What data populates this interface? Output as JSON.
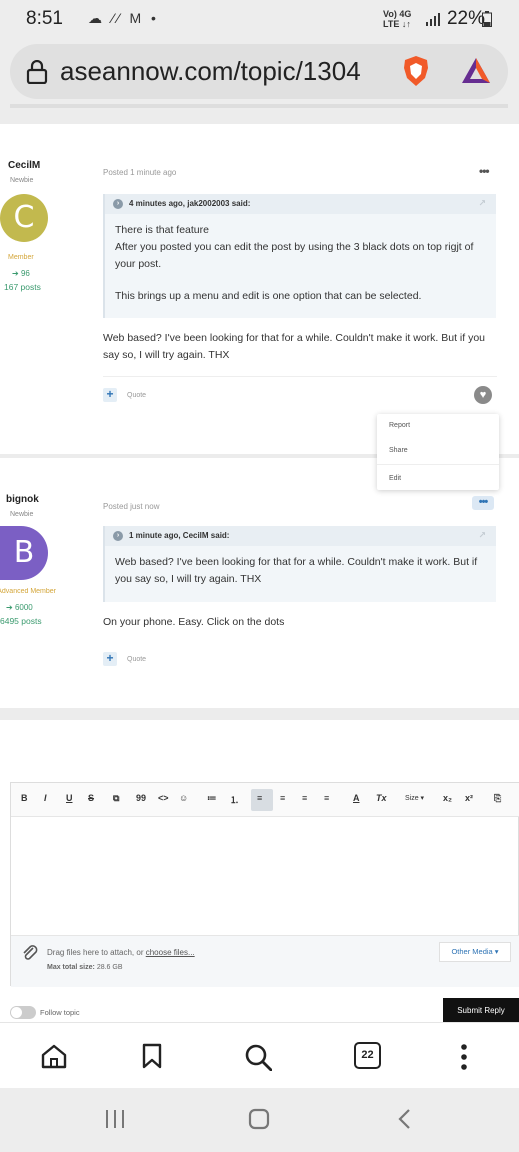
{
  "status_bar": {
    "time": "8:51",
    "left_icons": "☁ ⁄⁄ M •",
    "net_top": "Vo) 4G",
    "net_bottom": "LTE ↓↑",
    "battery": "22%"
  },
  "browser": {
    "url": "aseannow.com/topic/1304",
    "tab_count": "22"
  },
  "posts": [
    {
      "author": "CecilM",
      "rank": "Newbie",
      "avatar_letter": "C",
      "avatar_color": "#c2b94e",
      "group": "Member",
      "group_color": "#d4a63a",
      "reputation": "96",
      "post_count": "167 posts",
      "posted": "Posted 1 minute ago",
      "quote_header": "4 minutes ago, jak2002003 said:",
      "quote_lines": [
        "There is that feature",
        " After you posted you can edit the post by using the 3 black dots on top rigjt of your post.",
        "This brings up a menu and edit is one option that can be selected."
      ],
      "body": "Web based? I've been looking for that for a while. Couldn't make it work. But if you say so, I will try again. THX",
      "quote_label": "Quote"
    },
    {
      "author": "bignok",
      "rank": "Newbie",
      "avatar_letter": "B",
      "avatar_color": "#7b5fc4",
      "group": "Advanced Member",
      "group_color": "#d4a63a",
      "reputation": "6000",
      "post_count": "6495 posts",
      "posted": "Posted just now",
      "quote_header": "1 minute ago, CecilM said:",
      "quote_lines": [
        "Web based? I've been looking for that for a while. Couldn't make it work. But if you say so, I will try again. THX"
      ],
      "body": "On your phone. Easy. Click on the dots",
      "quote_label": "Quote"
    }
  ],
  "post_menu": {
    "items": [
      "Report",
      "Share",
      "Edit"
    ]
  },
  "editor": {
    "toolbar": [
      "B",
      "I",
      "U",
      "S",
      "⧉",
      "99",
      "<>",
      "☺",
      "≔",
      "⒈",
      "≡",
      "≡",
      "≡",
      "≡",
      "A",
      "Tx",
      "Size ▾",
      "x₂",
      "x²",
      "⎘"
    ],
    "attach_text": "Drag files here to attach, or",
    "choose_files": "choose files...",
    "max_size_label": "Max total size:",
    "max_size_value": "28.6 GB",
    "other_media": "Other Media ▾"
  },
  "footer": {
    "follow_topic": "Follow topic",
    "submit_reply": "Submit Reply"
  }
}
